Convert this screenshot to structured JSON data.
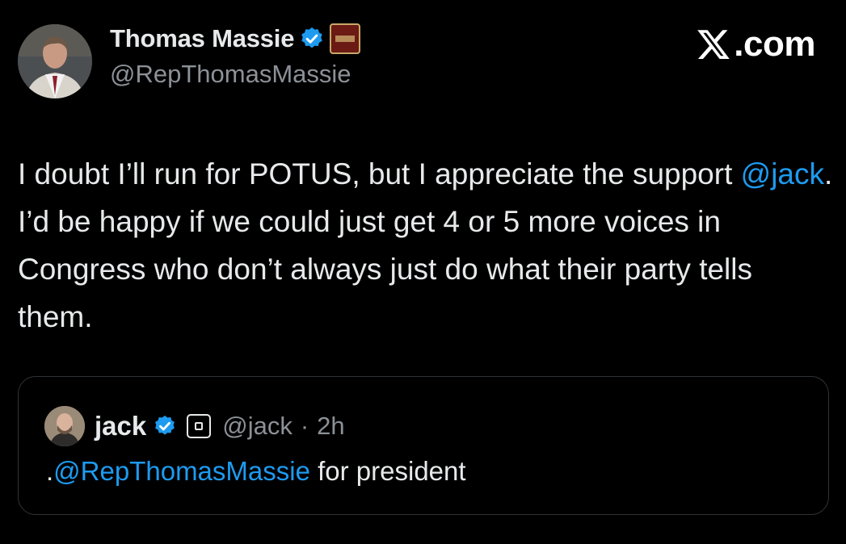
{
  "author": {
    "name": "Thomas Massie",
    "handle": "@RepThomasMassie"
  },
  "brand": {
    "label": ".com",
    "icon": "x-logo-icon"
  },
  "tweet": {
    "text_before": "I doubt I’ll run for POTUS, but I appreciate the support ",
    "mention": "@jack",
    "text_after": ". I’d be happy if we could just get 4 or 5 more voices in Congress who don’t always just do what their party tells them."
  },
  "quoted": {
    "name": "jack",
    "handle": "@jack",
    "separator": "·",
    "time": "2h",
    "text_prefix": ".",
    "mention": "@RepThomasMassie",
    "text_suffix": " for president"
  },
  "colors": {
    "background": "#000000",
    "text": "#e7e9ea",
    "secondary": "#8b9197",
    "link": "#1d9bf0",
    "verified": "#1d9bf0"
  }
}
